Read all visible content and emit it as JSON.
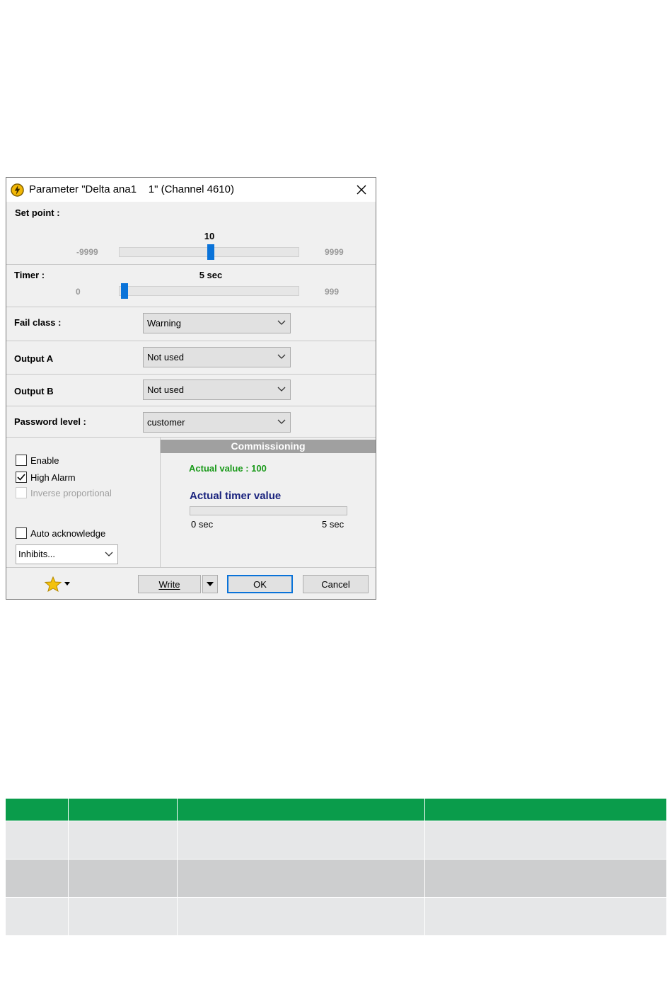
{
  "window": {
    "title": "Parameter \"Delta ana1    1\" (Channel 4610)"
  },
  "set_point": {
    "label": "Set point :",
    "value": "10",
    "min": "-9999",
    "max": "9999",
    "position_fraction": 0.5
  },
  "timer": {
    "label": "Timer :",
    "value": "5 sec",
    "min": "0",
    "max": "999",
    "position_fraction": 0.005
  },
  "fail_class": {
    "label": "Fail class :",
    "selected": "Warning"
  },
  "output_a": {
    "label": "Output A",
    "selected": "Not used"
  },
  "output_b": {
    "label": "Output B",
    "selected": "Not used"
  },
  "password_level": {
    "label": "Password level :",
    "selected": "customer"
  },
  "options": {
    "enable": {
      "label": "Enable",
      "checked": false
    },
    "high_alarm": {
      "label": "High Alarm",
      "checked": true
    },
    "inverse_proportional": {
      "label": "Inverse proportional",
      "checked": false,
      "disabled": true
    },
    "auto_acknowledge": {
      "label": "Auto acknowledge",
      "checked": false
    },
    "inhibits": {
      "selected": "Inhibits..."
    }
  },
  "commissioning": {
    "header": "Commissioning",
    "actual_value": "Actual value : 100",
    "timer_label": "Actual timer value",
    "timer_min": "0 sec",
    "timer_max": "5 sec",
    "timer_progress": 0
  },
  "footer": {
    "favorites_icon": "star-icon",
    "write_label": "Write",
    "ok_label": "OK",
    "cancel_label": "Cancel"
  },
  "colors": {
    "accent_blue": "#0a73d9",
    "actual_value_green": "#1a9a1a",
    "timer_label_navy": "#1a237e",
    "table_header_green": "#0a9c4b",
    "commissioning_header_gray": "#a0a0a0"
  }
}
